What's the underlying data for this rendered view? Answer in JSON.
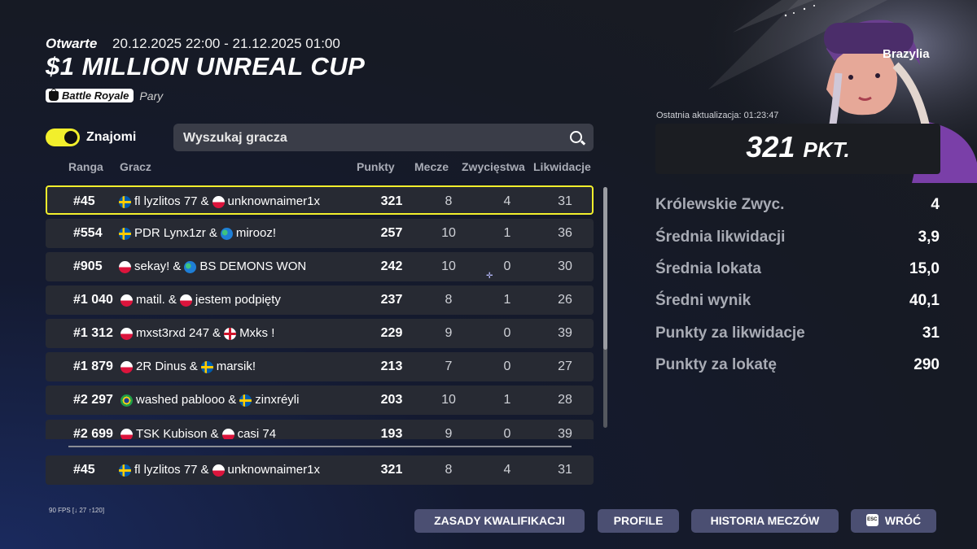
{
  "event": {
    "status": "Otwarte",
    "dates": "20.12.2025 22:00 - 21.12.2025 01:00",
    "title": "$1 MILLION UNREAL CUP",
    "mode": "Battle Royale",
    "mode_sub": "Pary"
  },
  "filters": {
    "friends_label": "Znajomi",
    "friends_toggle_on": true,
    "search_placeholder": "Wyszukaj gracza"
  },
  "table": {
    "headers": [
      "Ranga",
      "Gracz",
      "Punkty",
      "Mecze",
      "Zwycięstwa",
      "Likwidacje"
    ],
    "rows": [
      {
        "rank": "#45",
        "p1_flag": "sweden-flag-icon",
        "p1": "fl lyzlitos 77",
        "sep": "&",
        "p2_flag": "poland-flag-icon",
        "p2": "unknownaimer1x",
        "points": "321",
        "matches": "8",
        "wins": "4",
        "elims": "31",
        "highlighted": true
      },
      {
        "rank": "#554",
        "p1_flag": "sweden-flag-icon",
        "p1": "PDR Lynx1zr",
        "sep": "&",
        "p2_flag": "globe-icon",
        "p2": "mirooz!",
        "points": "257",
        "matches": "10",
        "wins": "1",
        "elims": "36"
      },
      {
        "rank": "#905",
        "p1_flag": "poland-flag-icon",
        "p1": "sekay!",
        "sep": "&",
        "p2_flag": "globe-icon",
        "p2": "BS DEMONS WON",
        "points": "242",
        "matches": "10",
        "wins": "0",
        "elims": "30"
      },
      {
        "rank": "#1 040",
        "p1_flag": "poland-flag-icon",
        "p1": "matil.",
        "sep": "&",
        "p2_flag": "poland-flag-icon",
        "p2": "jestem podpięty",
        "points": "237",
        "matches": "8",
        "wins": "1",
        "elims": "26"
      },
      {
        "rank": "#1 312",
        "p1_flag": "poland-flag-icon",
        "p1": "mxst3rxd 247",
        "sep": "&",
        "p2_flag": "england-flag-icon",
        "p2": "Mxks !",
        "points": "229",
        "matches": "9",
        "wins": "0",
        "elims": "39"
      },
      {
        "rank": "#1 879",
        "p1_flag": "poland-flag-icon",
        "p1": "2R Dinus",
        "sep": "&",
        "p2_flag": "sweden-flag-icon",
        "p2": "marsik!",
        "points": "213",
        "matches": "7",
        "wins": "0",
        "elims": "27"
      },
      {
        "rank": "#2 297",
        "p1_flag": "brazil-flag-icon",
        "p1": "washed pablooo",
        "sep": "&",
        "p2_flag": "sweden-flag-icon",
        "p2": "zinxréyli",
        "points": "203",
        "matches": "10",
        "wins": "1",
        "elims": "28"
      },
      {
        "rank": "#2 699",
        "p1_flag": "poland-flag-icon",
        "p1": "TSK Kubison",
        "sep": "&",
        "p2_flag": "poland-flag-icon",
        "p2": "casi 74",
        "points": "193",
        "matches": "9",
        "wins": "0",
        "elims": "39"
      }
    ],
    "pinned": {
      "rank": "#45",
      "p1": "fl lyzlitos 77",
      "sep": "&",
      "p2": "unknownaimer1x",
      "points": "321",
      "matches": "8",
      "wins": "4",
      "elims": "31"
    }
  },
  "summary": {
    "region": "Brazylia",
    "updated": "Ostatnia aktualizacja: 01:23:47",
    "points_value": "321",
    "points_unit": "PKT.",
    "stats": [
      {
        "label": "Królewskie Zwyc.",
        "value": "4"
      },
      {
        "label": "Średnia likwidacji",
        "value": "3,9"
      },
      {
        "label": "Średnia lokata",
        "value": "15,0"
      },
      {
        "label": "Średni wynik",
        "value": "40,1"
      },
      {
        "label": "Punkty za likwidacje",
        "value": "31"
      },
      {
        "label": "Punkty za lokatę",
        "value": "290"
      }
    ]
  },
  "footer": {
    "fps": "90 FPS [↓ 27 ↑120]",
    "buttons": [
      "ZASADY KWALIFIKACJI",
      "PROFILE",
      "HISTORIA MECZÓW",
      "WRÓĆ"
    ],
    "esc_key": "ESC"
  },
  "colors": {
    "accent_yellow": "#f2ef2c",
    "button_bg": "#4b4f72",
    "row_bg": "#272a33"
  }
}
